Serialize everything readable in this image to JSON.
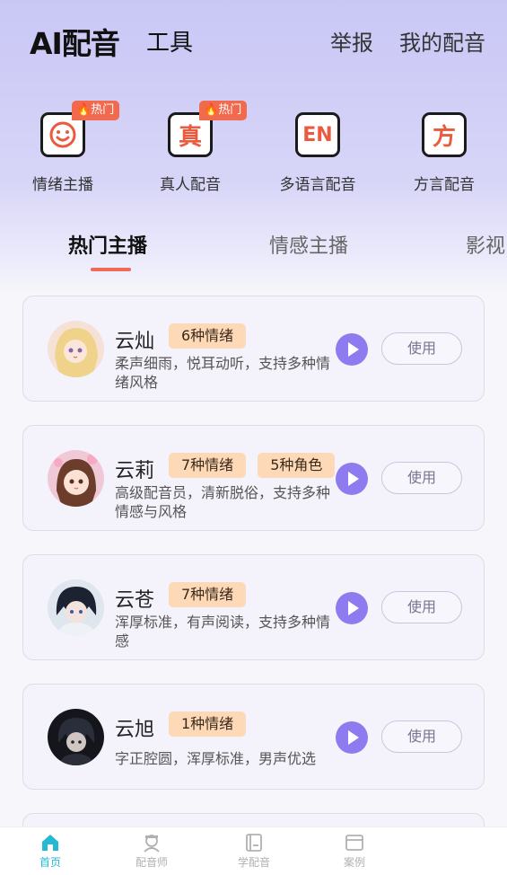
{
  "header": {
    "title": "AI配音",
    "tool": "工具",
    "report": "举报",
    "my_dubbing": "我的配音"
  },
  "categories": [
    {
      "label": "情绪主播",
      "icon": "smile-face-icon",
      "badge": "热门"
    },
    {
      "label": "真人配音",
      "icon": "zhen-char-icon",
      "glyph": "真",
      "badge": "热门"
    },
    {
      "label": "多语言配音",
      "icon": "en-language-icon",
      "glyph": "EN"
    },
    {
      "label": "方言配音",
      "icon": "fang-char-icon",
      "glyph": "方"
    }
  ],
  "tabs": [
    {
      "label": "热门主播",
      "active": true
    },
    {
      "label": "情感主播"
    },
    {
      "label": "影视"
    }
  ],
  "voices": [
    {
      "name": "云灿",
      "tags": [
        "6种情绪"
      ],
      "desc": "柔声细雨，悦耳动听，支持多种情绪风格",
      "use": "使用"
    },
    {
      "name": "云莉",
      "tags": [
        "7种情绪",
        "5种角色"
      ],
      "desc": "高级配音员，清新脱俗，支持多种情感与风格",
      "use": "使用"
    },
    {
      "name": "云苍",
      "tags": [
        "7种情绪"
      ],
      "desc": "浑厚标准，有声阅读，支持多种情感",
      "use": "使用"
    },
    {
      "name": "云旭",
      "tags": [
        "1种情绪"
      ],
      "desc": "字正腔圆，浑厚标准，男声优选",
      "use": "使用"
    }
  ],
  "bottom_nav": [
    {
      "label": "首页",
      "icon": "home-icon",
      "active": true
    },
    {
      "label": "配音师",
      "icon": "voice-actor-icon"
    },
    {
      "label": "学配音",
      "icon": "book-icon"
    },
    {
      "label": "案例",
      "icon": "case-icon"
    }
  ],
  "colors": {
    "accent": "#8f7bf0",
    "hot": "#f26a4e",
    "tag": "#fdd9b7",
    "active_nav": "#25b9d6"
  }
}
